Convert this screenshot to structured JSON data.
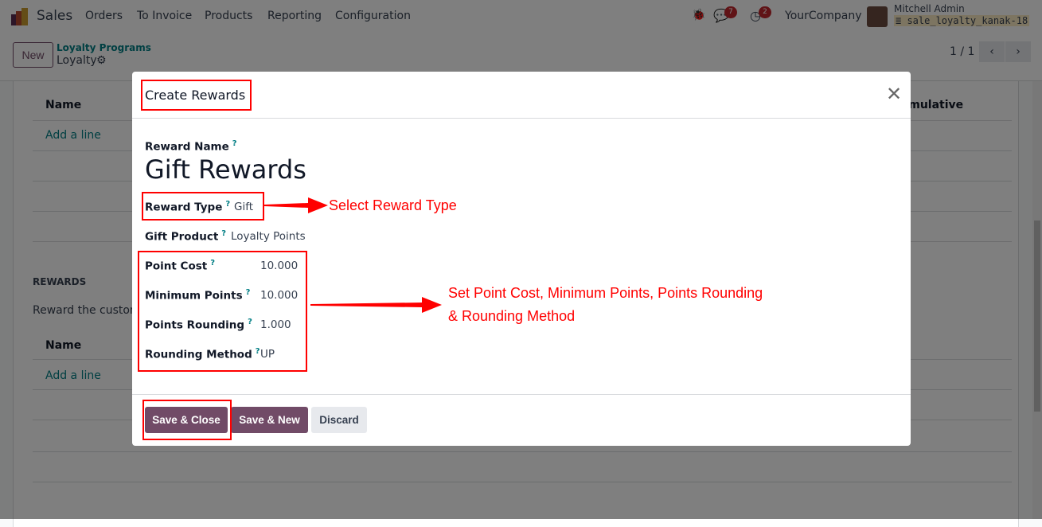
{
  "navbar": {
    "app": "Sales",
    "menus": [
      "Orders",
      "To Invoice",
      "Products",
      "Reporting",
      "Configuration"
    ],
    "chat_count": "7",
    "activity_count": "2",
    "company": "YourCompany",
    "user": "Mitchell Admin",
    "database": "sale_loyalty_kanak-18"
  },
  "control": {
    "new_label": "New",
    "breadcrumb_parent": "Loyalty Programs",
    "breadcrumb_current": "Loyalty",
    "pager": "1 / 1"
  },
  "background": {
    "name_header": "Name",
    "add_line": "Add a line",
    "cumulative_header": "Cumulative",
    "rewards_title": "REWARDS",
    "rewards_desc": "Reward the customer",
    "name_header2": "Name",
    "add_line2": "Add a line"
  },
  "modal": {
    "title": "Create Rewards",
    "reward_name_label": "Reward Name",
    "reward_name": "Gift Rewards",
    "fields": [
      {
        "label": "Reward Type",
        "value": "Gift"
      },
      {
        "label": "Gift Product",
        "value": "Loyalty Points"
      },
      {
        "label": "Point Cost",
        "value": "10.000"
      },
      {
        "label": "Minimum Points",
        "value": "10.000"
      },
      {
        "label": "Points Rounding",
        "value": "1.000"
      },
      {
        "label": "Rounding Method",
        "value": "UP"
      }
    ],
    "help": "?",
    "save_close": "Save & Close",
    "save_new": "Save & New",
    "discard": "Discard"
  },
  "annotations": {
    "reward_type": "Select Reward Type",
    "points_line1": "Set Point Cost, Minimum Points, Points Rounding",
    "points_line2": "& Rounding Method"
  },
  "colors": {
    "primary": "#714b67",
    "annotation": "#ff0000",
    "link": "#017e84"
  }
}
